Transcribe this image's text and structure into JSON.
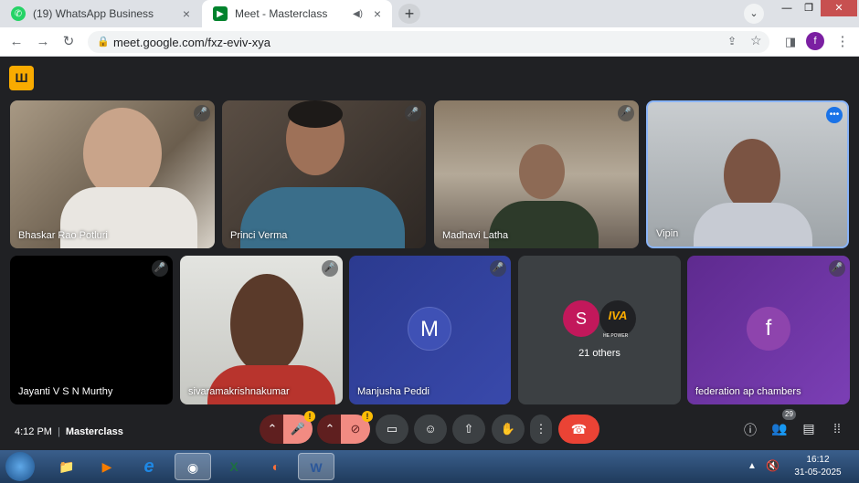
{
  "browser": {
    "tabs": [
      {
        "label": "(19) WhatsApp Business",
        "close": "×"
      },
      {
        "label": "Meet - Masterclass",
        "audio": "◀)",
        "close": "×"
      }
    ],
    "new_tab": "+",
    "url": "meet.google.com/fxz-eviv-xya",
    "profile_initial": "f"
  },
  "meet": {
    "participants": [
      {
        "name": "Bhaskar Rao Potluri"
      },
      {
        "name": "Princi Verma"
      },
      {
        "name": "Madhavi Latha"
      },
      {
        "name": "Vipin"
      },
      {
        "name": "Jayanti V S N Murthy"
      },
      {
        "name": "sivaramakrishnakumar"
      },
      {
        "name": "Manjusha Peddi",
        "initial": "M"
      },
      {
        "name": "21 others",
        "initial": "S"
      },
      {
        "name": "federation ap chambers",
        "initial": "f"
      }
    ],
    "others_logo_text": "IVA",
    "others_logo_sub": "HE POWER",
    "time": "4:12 PM",
    "meeting_name": "Masterclass",
    "participant_count": "29",
    "warn": "!"
  },
  "taskbar": {
    "time": "16:12",
    "date": "31-05-2025"
  }
}
